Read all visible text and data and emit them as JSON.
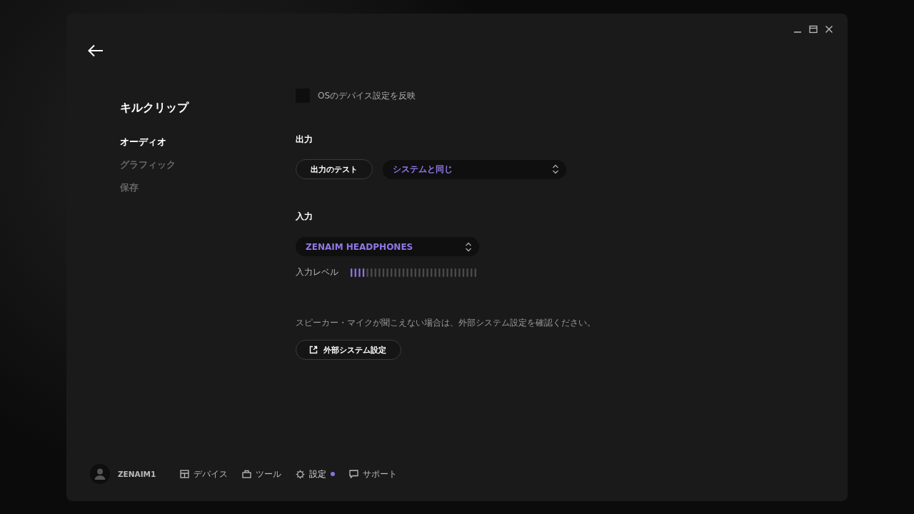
{
  "sidebar": {
    "title": "キルクリップ",
    "items": [
      {
        "label": "オーディオ",
        "selected": true
      },
      {
        "label": "グラフィック",
        "selected": false
      },
      {
        "label": "保存",
        "selected": false
      }
    ]
  },
  "os_sync": {
    "label": "OSのデバイス設定を反映",
    "checked": false
  },
  "output": {
    "heading": "出力",
    "test_button": "出力のテスト",
    "device": "システムと同じ"
  },
  "input": {
    "heading": "入力",
    "device": "ZENAIM HEADPHONES",
    "level_label": "入力レベル",
    "level": 0.125
  },
  "help_text": "スピーカー・マイクが聞こえない場合は、外部システム設定を確認ください。",
  "external_button": "外部システム設定",
  "footer": {
    "user": "ZENAIM1",
    "nav": [
      {
        "kind": "devices",
        "label": "デバイス",
        "selected": false,
        "dot": false
      },
      {
        "kind": "tools",
        "label": "ツール",
        "selected": false,
        "dot": false
      },
      {
        "kind": "settings",
        "label": "設定",
        "selected": true,
        "dot": true
      },
      {
        "kind": "support",
        "label": "サポート",
        "selected": false,
        "dot": false
      }
    ]
  }
}
